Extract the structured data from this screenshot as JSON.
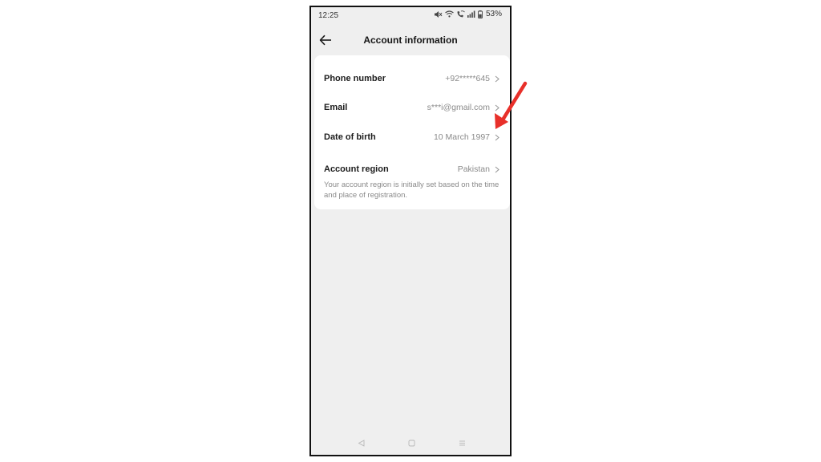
{
  "status_bar": {
    "time": "12:25",
    "battery": "53%",
    "icons": [
      "mute-icon",
      "wifi-icon",
      "wifi-calling-icon",
      "signal-icon",
      "battery-icon"
    ]
  },
  "header": {
    "title": "Account information",
    "back_icon": "arrow-left-icon"
  },
  "account_rows": [
    {
      "label": "Phone number",
      "value": "+92*****645"
    },
    {
      "label": "Email",
      "value": "s***i@gmail.com"
    },
    {
      "label": "Date of birth",
      "value": "10 March 1997"
    },
    {
      "label": "Account region",
      "value": "Pakistan"
    }
  ],
  "region_note": "Your account region is initially set based on the time and place of registration.",
  "nav_bar": {
    "icons": [
      "nav-back-icon",
      "nav-home-icon",
      "nav-recents-icon"
    ]
  },
  "colors": {
    "background": "#efefef",
    "card": "#ffffff",
    "label": "#1c1c1c",
    "value": "#8a8a8a",
    "annotation_arrow": "#e8302a"
  }
}
